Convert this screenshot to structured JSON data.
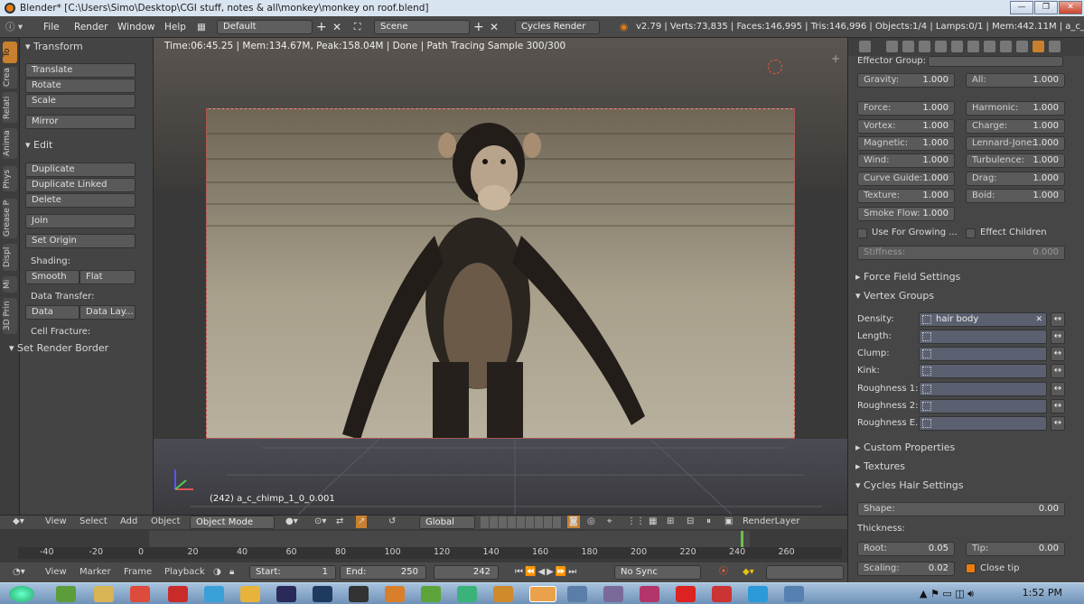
{
  "window": {
    "title": "Blender* [C:\\Users\\Simo\\Desktop\\CGI stuff, notes & all\\monkey\\monkey on roof.blend]",
    "min": "—",
    "max": "❐",
    "close": "✕"
  },
  "infobar": {
    "menus": [
      "File",
      "Render",
      "Window",
      "Help"
    ],
    "layout": "Default",
    "scene": "Scene",
    "engine": "Cycles Render",
    "stats": "v2.79 | Verts:73,835 | Faces:146,995 | Tris:146,996 | Objects:1/4 | Lamps:0/1 | Mem:442.11M | a_c_chimp_1_0"
  },
  "lefttabs": [
    "To",
    "Crea",
    "Relati",
    "Anima",
    "Phys",
    "Grease P",
    "Displ",
    "Mi",
    "3D Prin"
  ],
  "toolshelf": {
    "transform_header": "Transform",
    "translate": "Translate",
    "rotate": "Rotate",
    "scale": "Scale",
    "mirror": "Mirror",
    "edit_header": "Edit",
    "duplicate": "Duplicate",
    "duplicate_linked": "Duplicate Linked",
    "delete": "Delete",
    "join": "Join",
    "set_origin": "Set Origin",
    "shading_label": "Shading:",
    "smooth": "Smooth",
    "flat": "Flat",
    "data_transfer_label": "Data Transfer:",
    "data": "Data",
    "data_lay": "Data Lay...",
    "cell_fracture_label": "Cell Fracture:",
    "set_render_border": "Set Render Border"
  },
  "viewport": {
    "info": "Time:06:45.25 | Mem:134.67M, Peak:158.04M | Done | Path Tracing Sample 300/300",
    "object_label": "(242) a_c_chimp_1_0_0.001"
  },
  "props": {
    "effector_group": "Effector Group:",
    "gravity": {
      "label": "Gravity:",
      "value": "1.000"
    },
    "all": {
      "label": "All:",
      "value": "1.000"
    },
    "left": [
      {
        "label": "Force:",
        "value": "1.000"
      },
      {
        "label": "Vortex:",
        "value": "1.000"
      },
      {
        "label": "Magnetic:",
        "value": "1.000"
      },
      {
        "label": "Wind:",
        "value": "1.000"
      },
      {
        "label": "Curve Guide:",
        "value": "1.000"
      },
      {
        "label": "Texture:",
        "value": "1.000"
      },
      {
        "label": "Smoke Flow:",
        "value": "1.000"
      }
    ],
    "right": [
      {
        "label": "Harmonic:",
        "value": "1.000"
      },
      {
        "label": "Charge:",
        "value": "1.000"
      },
      {
        "label": "Lennard-Jone:",
        "value": "1.000"
      },
      {
        "label": "Turbulence:",
        "value": "1.000"
      },
      {
        "label": "Drag:",
        "value": "1.000"
      },
      {
        "label": "Boid:",
        "value": "1.000"
      }
    ],
    "use_growing": "Use For Growing ...",
    "effect_children": "Effect Children",
    "stiffness": {
      "label": "Stiffness:",
      "value": "0.000"
    },
    "force_field_settings": "Force Field Settings",
    "vertex_groups": "Vertex Groups",
    "vg_rows": [
      {
        "label": "Density:",
        "value": "hair body"
      },
      {
        "label": "Length:",
        "value": ""
      },
      {
        "label": "Clump:",
        "value": ""
      },
      {
        "label": "Kink:",
        "value": ""
      },
      {
        "label": "Roughness 1:",
        "value": ""
      },
      {
        "label": "Roughness 2:",
        "value": ""
      },
      {
        "label": "Roughness E...",
        "value": ""
      }
    ],
    "custom_properties": "Custom Properties",
    "textures": "Textures",
    "cycles_hair": "Cycles Hair Settings",
    "shape": {
      "label": "Shape:",
      "value": "0.00"
    },
    "thickness": "Thickness:",
    "root": {
      "label": "Root:",
      "value": "0.05"
    },
    "tip": {
      "label": "Tip:",
      "value": "0.00"
    },
    "scaling": {
      "label": "Scaling:",
      "value": "0.02"
    },
    "close_tip": "Close tip"
  },
  "viewhdr": {
    "view": "View",
    "select": "Select",
    "add": "Add",
    "object": "Object",
    "mode": "Object Mode",
    "orientation": "Global",
    "renderlayer": "RenderLayer"
  },
  "timeline": {
    "ticks": [
      "-40",
      "-20",
      "0",
      "20",
      "40",
      "60",
      "80",
      "100",
      "120",
      "140",
      "160",
      "180",
      "200",
      "220",
      "240",
      "260"
    ],
    "current_frame_marker": 242
  },
  "tlhdr": {
    "view": "View",
    "marker": "Marker",
    "frame": "Frame",
    "playback": "Playback",
    "start": "Start:",
    "start_val": "1",
    "end": "End:",
    "end_val": "250",
    "current": "242",
    "sync": "No Sync"
  },
  "taskbar": {
    "time": "1:52 PM"
  },
  "colors": {
    "accent": "#e87d0d",
    "render_border": "#c85050",
    "frame_marker": "#6cc24a"
  }
}
